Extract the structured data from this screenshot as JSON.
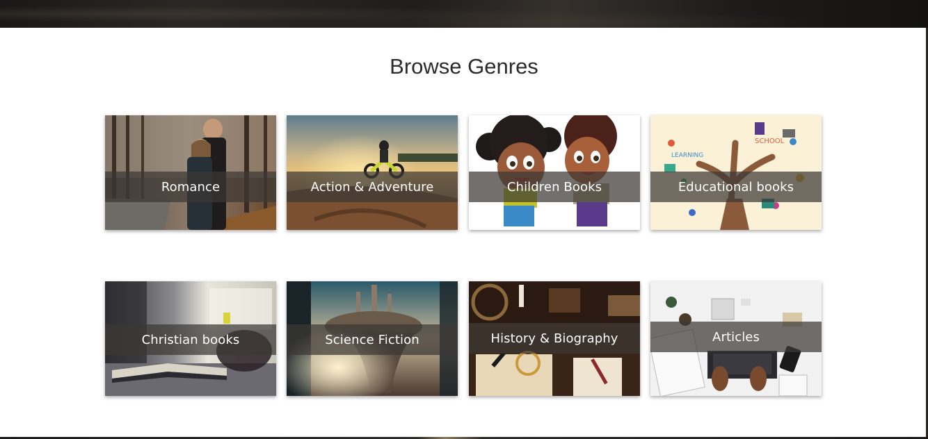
{
  "section": {
    "title": "Browse Genres"
  },
  "genres": [
    {
      "label": "Romance",
      "icon": "romance-image"
    },
    {
      "label": "Action & Adventure",
      "icon": "action-adventure-image"
    },
    {
      "label": "Children Books",
      "icon": "children-books-image"
    },
    {
      "label": "Educational books",
      "icon": "educational-books-image"
    },
    {
      "label": "Christian books",
      "icon": "christian-books-image"
    },
    {
      "label": "Science Fiction",
      "icon": "science-fiction-image"
    },
    {
      "label": "History & Biography",
      "icon": "history-biography-image"
    },
    {
      "label": "Articles",
      "icon": "articles-image"
    }
  ],
  "colors": {
    "title_text": "#2b2b2b",
    "band_overlay": "rgba(60,55,52,0.72)",
    "label_text": "#ffffff",
    "background": "#ffffff"
  }
}
